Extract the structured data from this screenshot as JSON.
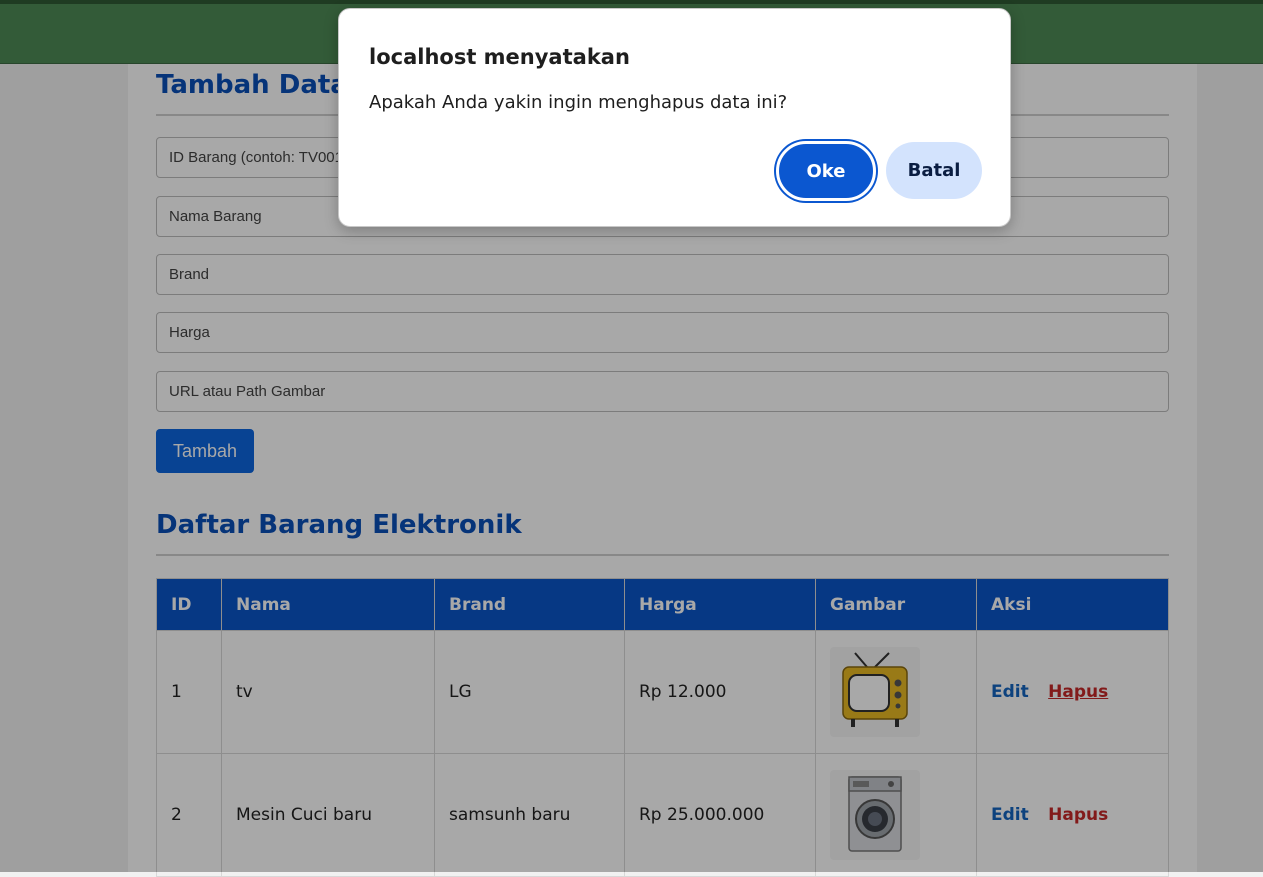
{
  "form": {
    "heading": "Tambah Data Barang Elektronik",
    "id_placeholder": "ID Barang (contoh: TV001)",
    "nama_placeholder": "Nama Barang",
    "brand_placeholder": "Brand",
    "harga_placeholder": "Harga",
    "gambar_placeholder": "URL atau Path Gambar",
    "submit_label": "Tambah"
  },
  "list": {
    "heading": "Daftar Barang Elektronik",
    "columns": [
      "ID",
      "Nama",
      "Brand",
      "Harga",
      "Gambar",
      "Aksi"
    ],
    "rows": [
      {
        "id": "1",
        "nama": "tv",
        "brand": "LG",
        "harga": "Rp 12.000",
        "image_icon": "tv-icon",
        "edit": "Edit",
        "hapus": "Hapus"
      },
      {
        "id": "2",
        "nama": "Mesin Cuci baru",
        "brand": "samsunh baru",
        "harga": "Rp 25.000.000",
        "image_icon": "washing-machine-icon",
        "edit": "Edit",
        "hapus": "Hapus"
      }
    ]
  },
  "dialog": {
    "title": "localhost menyatakan",
    "message": "Apakah Anda yakin ingin menghapus data ini?",
    "ok_label": "Oke",
    "cancel_label": "Batal"
  },
  "colors": {
    "header_bar": "#4e8a55",
    "primary": "#0a56c9",
    "danger": "#c62828"
  }
}
